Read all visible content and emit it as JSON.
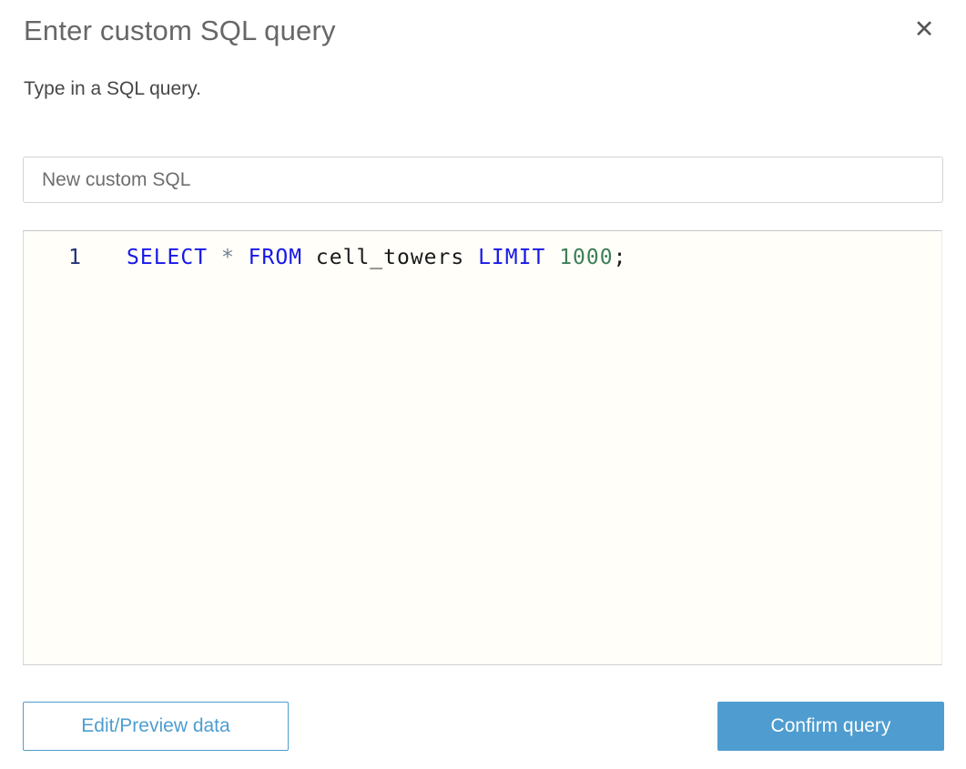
{
  "modal": {
    "title": "Enter custom SQL query",
    "subtitle": "Type in a SQL query.",
    "close_icon": "✕"
  },
  "name_input": {
    "value": "New custom SQL"
  },
  "editor": {
    "line_number": "1",
    "query_text": "SELECT * FROM cell_towers LIMIT 1000;",
    "tokens": [
      {
        "text": "SELECT",
        "type": "keyword"
      },
      {
        "text": " ",
        "type": "plain"
      },
      {
        "text": "*",
        "type": "operator"
      },
      {
        "text": " ",
        "type": "plain"
      },
      {
        "text": "FROM",
        "type": "keyword"
      },
      {
        "text": " cell_towers ",
        "type": "plain"
      },
      {
        "text": "LIMIT",
        "type": "keyword"
      },
      {
        "text": " ",
        "type": "plain"
      },
      {
        "text": "1000",
        "type": "number"
      },
      {
        "text": ";",
        "type": "plain"
      }
    ]
  },
  "buttons": {
    "edit_preview_label": "Edit/Preview data",
    "confirm_label": "Confirm query"
  },
  "colors": {
    "accent_blue": "#4f9dd0",
    "keyword": "#1718e8",
    "number": "#3d7f58",
    "operator": "#708090",
    "plain": "#1a1a1a",
    "line_number": "#223077",
    "editor_bg": "#fffef8"
  }
}
